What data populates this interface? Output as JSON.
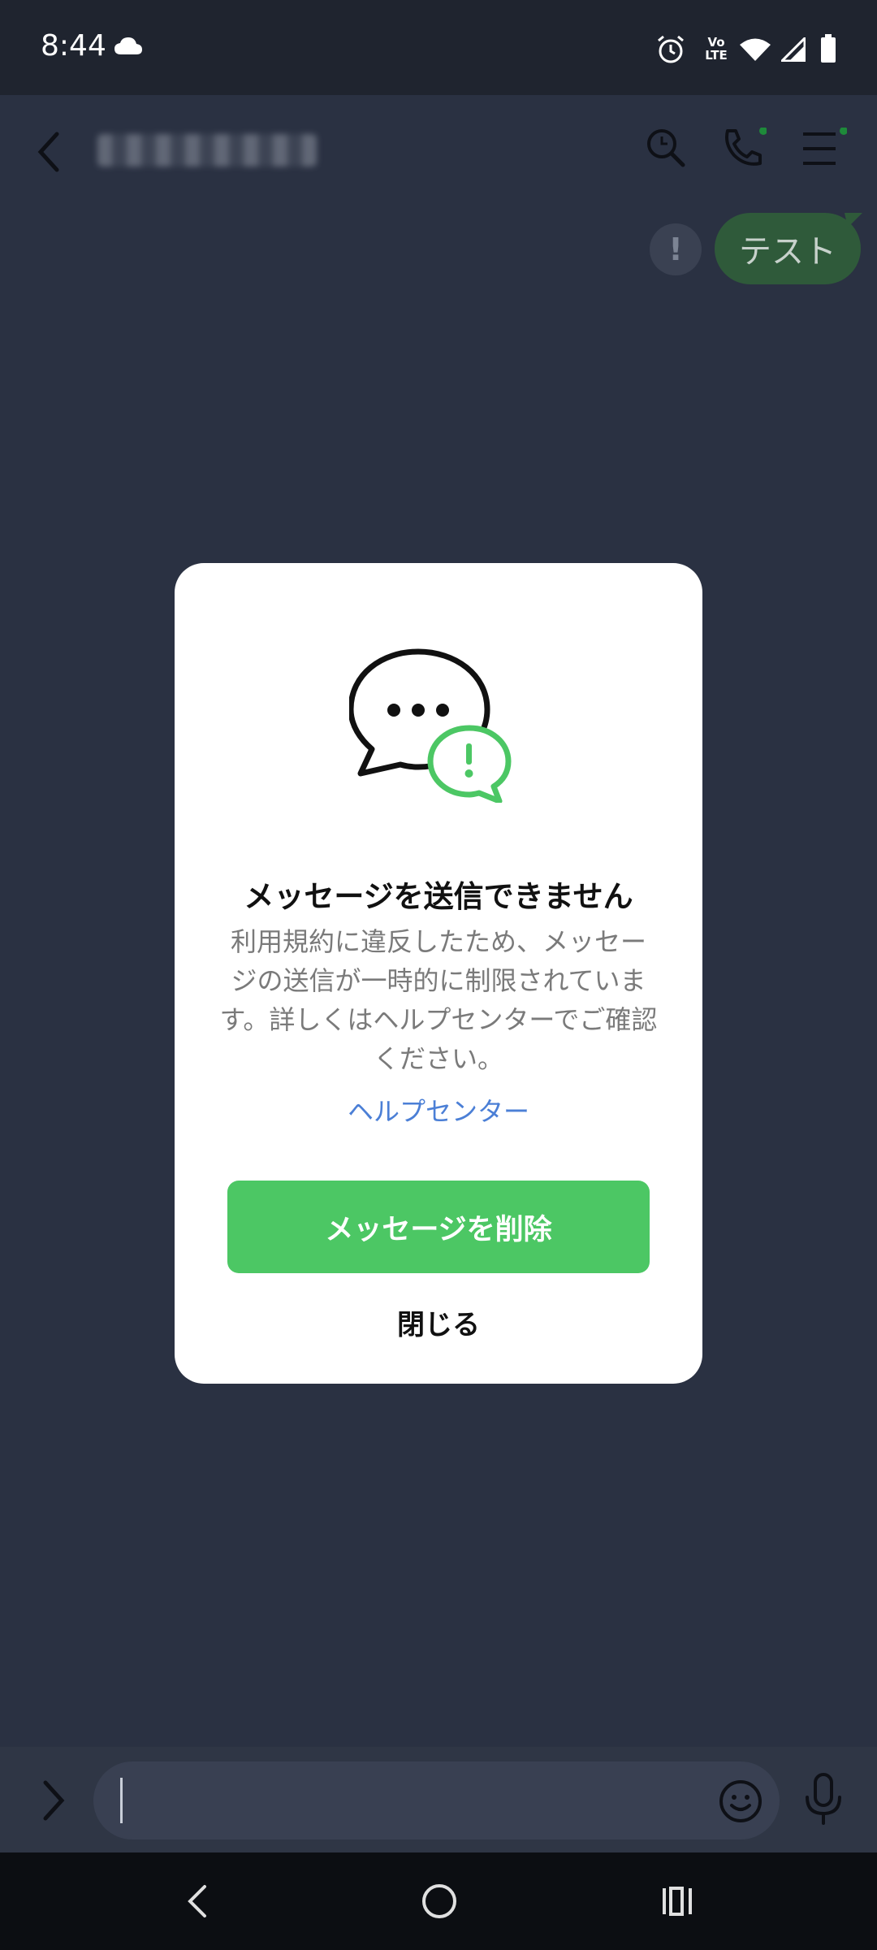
{
  "status_bar": {
    "time": "8:44",
    "icons": [
      "cloud-icon",
      "alarm-icon",
      "volte-icon",
      "wifi-icon",
      "signal-icon",
      "battery-icon"
    ],
    "volte_top": "Vo",
    "volte_bottom": "LTE"
  },
  "header": {
    "icons": [
      "back-icon",
      "search-icon",
      "phone-icon",
      "menu-icon"
    ]
  },
  "chat": {
    "sent_message": "テスト"
  },
  "dialog": {
    "title": "メッセージを送信できません",
    "body": "利用規約に違反したため、メッセージの送信が一時的に制限されています。詳しくはヘルプセンターでご確認ください。",
    "help_link": "ヘルプセンター",
    "primary_button": "メッセージを削除",
    "close_button": "閉じる"
  },
  "composer": {
    "icons": [
      "expand-icon",
      "emoji-icon",
      "mic-icon"
    ]
  },
  "nav_bar": {
    "icons": [
      "nav-back-icon",
      "home-icon",
      "recents-icon"
    ]
  },
  "colors": {
    "accent_green": "#4cc764",
    "link_blue": "#4b7fd6",
    "overlay_bg": "#2a3142"
  }
}
